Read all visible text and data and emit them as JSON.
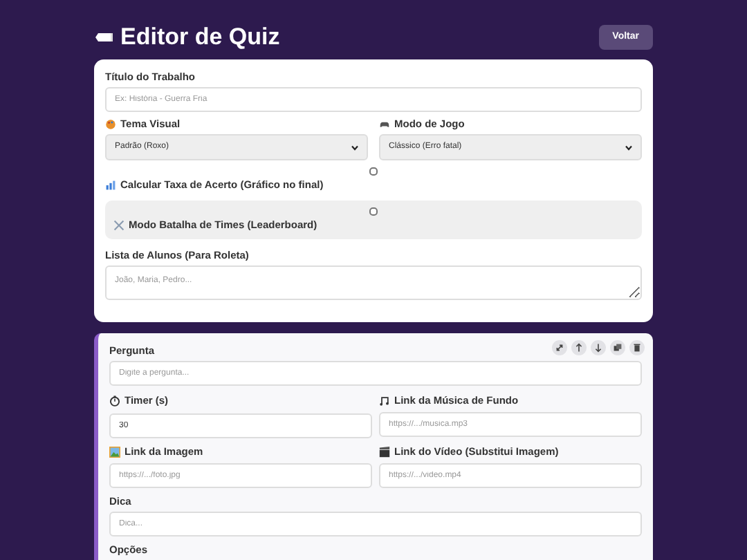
{
  "header": {
    "title": "Editor de Quiz",
    "back_button": "Voltar"
  },
  "settings": {
    "title_field": {
      "label": "Título do Trabalho",
      "placeholder": "Ex: História - Guerra Fria"
    },
    "selects": [
      {
        "label": "Tema Visual",
        "value": "Padrão (Roxo)"
      },
      {
        "label": "Modo de Jogo",
        "value": "Clássico (Erro fatal)"
      }
    ],
    "toggles": [
      {
        "label": "Calcular Taxa de Acerto (Gráfico no final)",
        "checked": false,
        "highlighted": false
      },
      {
        "label": "Modo Batalha de Times (Leaderboard)",
        "checked": false,
        "highlighted": true
      }
    ],
    "students": {
      "label": "Lista de Alunos (Para Roleta)",
      "placeholder": "João, Maria, Pedro..."
    }
  },
  "question": {
    "question_field": {
      "label": "Pergunta",
      "placeholder": "Digite a pergunta..."
    },
    "fields": [
      {
        "label": "Timer (s)",
        "value": "30"
      },
      {
        "label": "Link da Música de Fundo",
        "placeholder": "https://.../musica.mp3"
      },
      {
        "label": "Link da Imagem",
        "placeholder": "https://.../foto.jpg"
      },
      {
        "label": "Link do Vídeo (Substitui Imagem)",
        "placeholder": "https://.../video.mp4"
      }
    ],
    "hint_field": {
      "label": "Dica",
      "placeholder": "Dica..."
    },
    "options_label": "Opções"
  }
}
